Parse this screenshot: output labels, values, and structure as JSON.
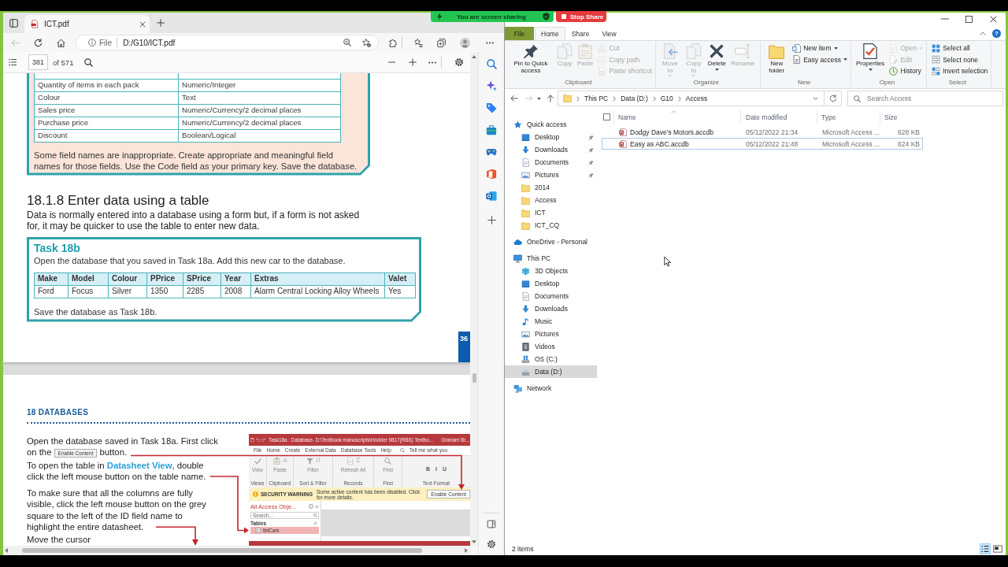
{
  "screen_share": {
    "status": "You are screen sharing",
    "stop": "Stop Share"
  },
  "browser": {
    "tabs": [
      {
        "title": "ICT.pdf",
        "selected": true
      }
    ],
    "back": {
      "disabled": true
    },
    "address": {
      "scheme": "File",
      "url": "D:/G10/ICT.pdf"
    },
    "pdf_toolbar": {
      "page": "381",
      "page_count": "of 571"
    },
    "pdf": {
      "field_rows": [
        [
          "Quantity of items in each pack",
          "Numeric/Integer"
        ],
        [
          "Colour",
          "Text"
        ],
        [
          "Sales price",
          "Numeric/Currency/2 decimal places"
        ],
        [
          "Purchase price",
          "Numeric/Currency/2 decimal places"
        ],
        [
          "Discount",
          "Boolean/Logical"
        ]
      ],
      "field_note": "Some field names are inappropriate. Create appropriate and meaningful field names for those fields. Use the Code field as your primary key. Save the database.",
      "heading": "18.1.8 Enter data using a table",
      "intro": "Data is normally entered into a database using a form but, if a form is not asked for, it may be quicker to use the table to enter new data.",
      "task": {
        "title": "Task 18b",
        "instruction": "Open the database that you saved in Task 18a. Add this new car to the database.",
        "columns": [
          "Make",
          "Model",
          "Colour",
          "PPrice",
          "SPrice",
          "Year",
          "Extras",
          "Valet"
        ],
        "rows": [
          [
            "Ford",
            "Focus",
            "Silver",
            "1350",
            "2285",
            "2008",
            "Alarm Central Locking Alloy Wheels",
            "Yes"
          ]
        ],
        "footer": "Save the database as Task 18b."
      },
      "page_number": "36",
      "chapter": "18 DATABASES",
      "steps": [
        {
          "kind": "button",
          "before": "Open the database saved in Task 18a. First click on the",
          "button": "Enable Content",
          "after": "button."
        },
        {
          "kind": "text",
          "text": "To open the table in **Datasheet View**, double click the left mouse button on the table name."
        },
        {
          "kind": "text",
          "text": "To make sure that all the columns are fully visible, click the left mouse button on the grey square to the left of the ID field name to highlight the entire datasheet."
        },
        {
          "kind": "text",
          "text": "Move the cursor"
        }
      ],
      "screenshot": {
        "title": "Task18a : Database- D:\\Textbook manuscripts\\Hodder 9817(RBS) Textbo...",
        "user": "Graham Br...",
        "tabs": [
          "File",
          "Home",
          "Create",
          "External Data",
          "Database Tools",
          "Help"
        ],
        "tell_me": "Tell me what you",
        "groups": [
          {
            "label": "Views",
            "kind": "large",
            "button": "View"
          },
          {
            "label": "Clipboard",
            "kind": "large",
            "button": "Paste"
          },
          {
            "label": "Sort & Filter",
            "kind": "large",
            "button": "Filter"
          },
          {
            "label": "Records",
            "kind": "large",
            "button": "Refresh All"
          },
          {
            "label": "Find",
            "kind": "large",
            "button": "Find"
          },
          {
            "label": "Text Format",
            "kind": "format",
            "buttons": [
              "B",
              "I",
              "U"
            ]
          }
        ],
        "warning": {
          "title": "SECURITY WARNING",
          "message": "Some active content has been disabled. Click for more details.",
          "button": "Enable Content"
        },
        "nav": {
          "title": "All Access Obje...",
          "search": "Search...",
          "group": "Tables",
          "items": [
            {
              "label": "tblCars",
              "selected": true
            }
          ]
        }
      }
    }
  },
  "explorer": {
    "tabs": [
      {
        "label": "File",
        "kind": "file",
        "selected": false
      },
      {
        "label": "Home",
        "kind": "tab",
        "selected": true
      },
      {
        "label": "Share",
        "kind": "tab",
        "selected": false
      },
      {
        "label": "View",
        "kind": "tab",
        "selected": false
      }
    ],
    "help": "?",
    "ribbon": [
      {
        "label": "Clipboard",
        "items": [
          {
            "kind": "large",
            "label": "Pin to Quick access",
            "disabled": false,
            "dropdown": false
          },
          {
            "kind": "large",
            "label": "Copy",
            "disabled": true,
            "dropdown": false
          },
          {
            "kind": "large",
            "label": "Paste",
            "disabled": true,
            "dropdown": false
          },
          {
            "kind": "small",
            "label": "Cut",
            "disabled": true,
            "dropdown": false
          },
          {
            "kind": "small",
            "label": "Copy path",
            "disabled": true,
            "dropdown": false
          },
          {
            "kind": "small",
            "label": "Paste shortcut",
            "disabled": true,
            "dropdown": false
          }
        ]
      },
      {
        "label": "Organize",
        "items": [
          {
            "kind": "large",
            "label": "Move to",
            "disabled": true,
            "dropdown": true
          },
          {
            "kind": "large",
            "label": "Copy to",
            "disabled": true,
            "dropdown": true
          },
          {
            "kind": "large",
            "label": "Delete",
            "disabled": false,
            "dropdown": true
          },
          {
            "kind": "large",
            "label": "Rename",
            "disabled": true,
            "dropdown": false
          }
        ]
      },
      {
        "label": "New",
        "items": [
          {
            "kind": "large",
            "label": "New folder",
            "disabled": false,
            "dropdown": false
          },
          {
            "kind": "small",
            "label": "New item",
            "disabled": false,
            "dropdown": true
          },
          {
            "kind": "small",
            "label": "Easy access",
            "disabled": false,
            "dropdown": true
          }
        ]
      },
      {
        "label": "Open",
        "items": [
          {
            "kind": "large",
            "label": "Properties",
            "disabled": false,
            "dropdown": true
          },
          {
            "kind": "small",
            "label": "Open",
            "disabled": true,
            "dropdown": true
          },
          {
            "kind": "small",
            "label": "Edit",
            "disabled": true,
            "dropdown": false
          },
          {
            "kind": "small",
            "label": "History",
            "disabled": false,
            "dropdown": false
          }
        ]
      },
      {
        "label": "Select",
        "items": [
          {
            "kind": "small",
            "label": "Select all",
            "disabled": false,
            "dropdown": false
          },
          {
            "kind": "small",
            "label": "Select none",
            "disabled": false,
            "dropdown": false
          },
          {
            "kind": "small",
            "label": "Invert selection",
            "disabled": false,
            "dropdown": false
          }
        ]
      }
    ],
    "back": {
      "disabled": false
    },
    "forward": {
      "disabled": true
    },
    "breadcrumbs": [
      "This PC",
      "Data (D:)",
      "G10",
      "Access"
    ],
    "search": {
      "placeholder": "Search Access"
    },
    "nav": [
      {
        "label": "Quick access",
        "kind": "quick",
        "selected": false,
        "children": [
          {
            "label": "Desktop",
            "kind": "desktop",
            "pinned": true,
            "selected": false
          },
          {
            "label": "Downloads",
            "kind": "downloads",
            "pinned": true,
            "selected": false
          },
          {
            "label": "Documents",
            "kind": "documents",
            "pinned": true,
            "selected": false
          },
          {
            "label": "Pictures",
            "kind": "pictures",
            "pinned": true,
            "selected": false
          },
          {
            "label": "2014",
            "kind": "folder",
            "pinned": false,
            "selected": false
          },
          {
            "label": "Access",
            "kind": "folder",
            "pinned": false,
            "selected": false
          },
          {
            "label": "ICT",
            "kind": "folder",
            "pinned": false,
            "selected": false
          },
          {
            "label": "ICT_CQ",
            "kind": "folder",
            "pinned": false,
            "selected": false
          }
        ]
      },
      {
        "label": "OneDrive - Personal",
        "kind": "cloud",
        "selected": false
      },
      {
        "label": "This PC",
        "kind": "computer",
        "selected": false,
        "children": [
          {
            "label": "3D Objects",
            "kind": "objects",
            "selected": false
          },
          {
            "label": "Desktop",
            "kind": "desktop",
            "selected": false
          },
          {
            "label": "Documents",
            "kind": "documents",
            "selected": false
          },
          {
            "label": "Downloads",
            "kind": "downloads",
            "selected": false
          },
          {
            "label": "Music",
            "kind": "music",
            "selected": false
          },
          {
            "label": "Pictures",
            "kind": "pictures",
            "selected": false
          },
          {
            "label": "Videos",
            "kind": "videos",
            "selected": false
          },
          {
            "label": "OS (C:)",
            "kind": "system",
            "selected": false
          },
          {
            "label": "Data (D:)",
            "kind": "drive",
            "selected": true
          }
        ]
      },
      {
        "label": "Network",
        "kind": "network",
        "selected": false
      }
    ],
    "select_all": {
      "checked": false
    },
    "columns": [
      {
        "label": "Name",
        "sorted": true
      },
      {
        "label": "Date modified",
        "sorted": false
      },
      {
        "label": "Type",
        "sorted": false
      },
      {
        "label": "Size",
        "sorted": false
      }
    ],
    "files": [
      {
        "name": "Dodgy Dave's Motors.accdb",
        "modified": "05/12/2022 21:34",
        "type": "Microsoft Access ...",
        "size": "628 KB",
        "selected": false,
        "focused": false
      },
      {
        "name": "Easy as ABC.accdb",
        "modified": "05/12/2022 21:48",
        "type": "Microsoft Access ...",
        "size": "624 KB",
        "selected": false,
        "focused": true
      }
    ],
    "status": "2 items",
    "views": [
      {
        "kind": "details",
        "selected": true
      },
      {
        "kind": "icons",
        "selected": false
      }
    ]
  }
}
